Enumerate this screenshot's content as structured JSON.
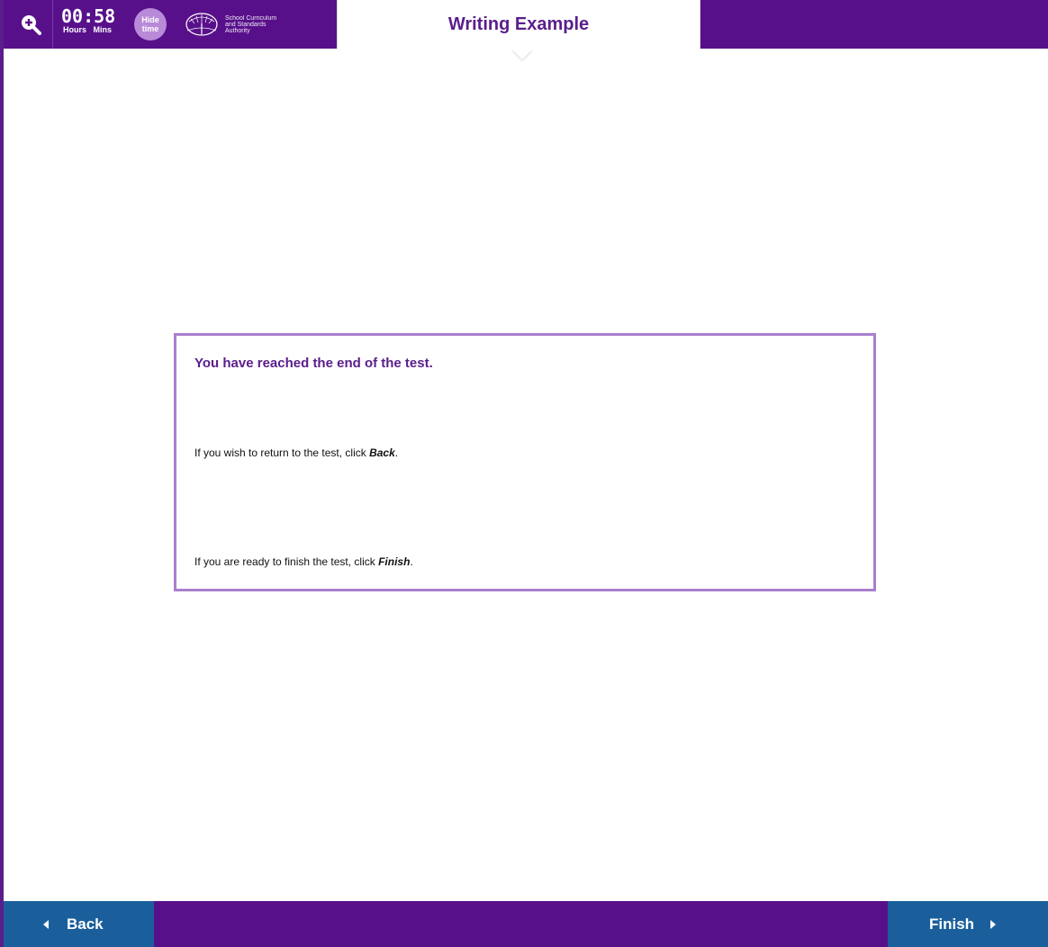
{
  "header": {
    "title": "Writing Example",
    "timer": {
      "hours": "00",
      "separator": ":",
      "minutes": "58",
      "hours_label": "Hours",
      "minutes_label": "Mins"
    },
    "hide_time_label_1": "Hide",
    "hide_time_label_2": "time",
    "logo_text": "School Curriculum\nand Standards\nAuthority",
    "zoom_icon": "zoom-in-icon"
  },
  "message": {
    "heading": "You have reached the end of the test.",
    "line1_prefix": "If you wish to return to the test, click ",
    "line1_emphasis": "Back",
    "line1_suffix": ".",
    "line2_prefix": "If you are ready to finish the test, click ",
    "line2_emphasis": "Finish",
    "line2_suffix": "."
  },
  "footer": {
    "back_label": "Back",
    "finish_label": "Finish"
  },
  "colors": {
    "brand_purple": "#58108a",
    "title_purple": "#5a1d8c",
    "box_border": "#a97fcd",
    "nav_blue": "#1a5f9c",
    "hide_time_bg": "#b88ad8"
  }
}
